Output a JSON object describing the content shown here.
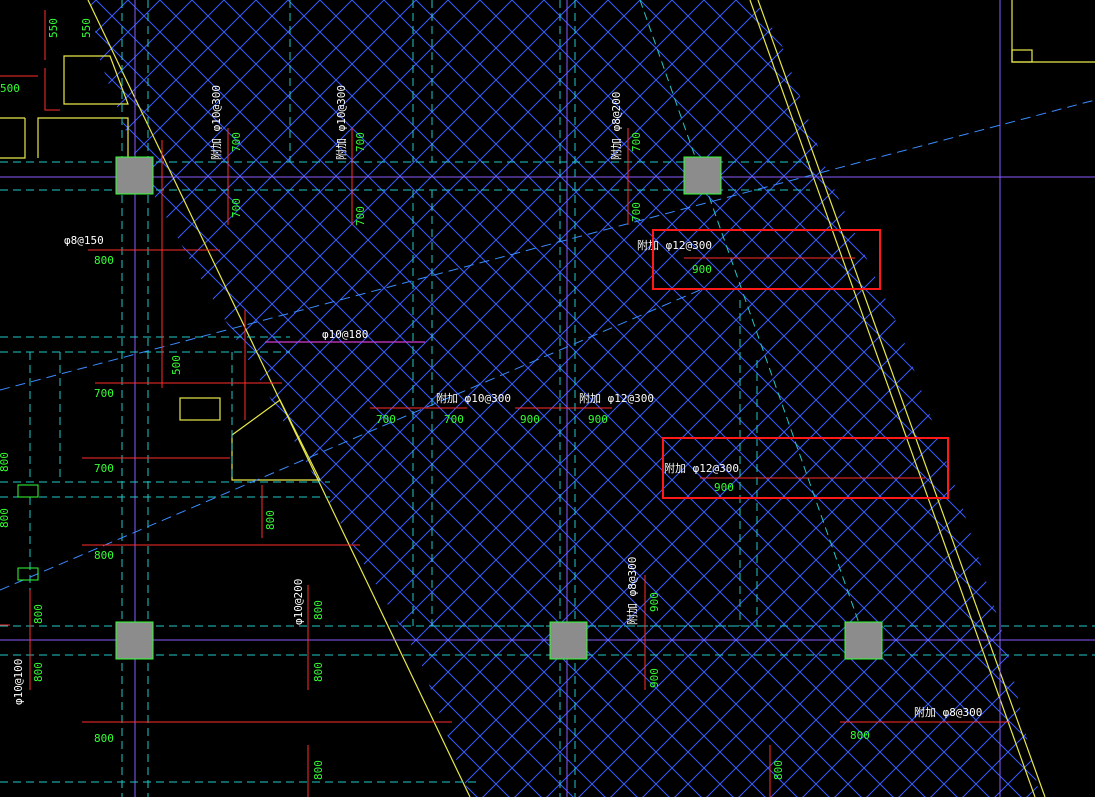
{
  "drawing": {
    "colors": {
      "background": "#000000",
      "hatch": "#3a5cff",
      "dash_cyan": "#22c7c7",
      "axis": "#8a5cff",
      "dim_red": "#ff2b2b",
      "text_green": "#33ff33",
      "text_white": "#ffffff",
      "yellow": "#e8e84a",
      "column": "#8c8c8c",
      "highlight": "#ff1a1a",
      "magenta": "#d23bd2"
    },
    "labels": {
      "l550a": "550",
      "l550b": "550",
      "l500": "500",
      "v1_spec": "附加 φ10@300",
      "v1_top": "700",
      "v1_bot": "700",
      "v2_spec": "附加 φ10@300",
      "v2_top": "700",
      "v2_bot": "700",
      "v3_spec": "附加 φ8@200",
      "v3_top": "700",
      "v3_bot": "700",
      "p8_150": "φ8@150",
      "l800_a": "800",
      "l500_b": "500",
      "p10_180": "φ10@180",
      "l700_a": "700",
      "l700_b": "700",
      "h1_spec": "附加 φ10@300",
      "h1_l": "700",
      "h1_r": "700",
      "h2_spec": "附加 φ12@300",
      "h2_l": "900",
      "h2_r": "900",
      "box1_spec": "附加 φ12@300",
      "box1_val": "900",
      "box2_spec": "附加 φ12@300",
      "box2_val": "900",
      "l800_left1": "800",
      "l800_left2": "800",
      "l800_b": "800",
      "l800_c": "800",
      "l800_d": "800",
      "v4_spec": "φ10@200",
      "v4_top": "800",
      "v4_bot": "800",
      "v5_spec": "附加 φ8@300",
      "v5_top": "900",
      "v5_bot": "900",
      "v6_spec": "φ10@100",
      "v6_val": "800",
      "l800_e": "800",
      "l800_f": "800",
      "l800_g": "800",
      "br_spec": "附加 φ8@300",
      "br_val": "800"
    }
  }
}
